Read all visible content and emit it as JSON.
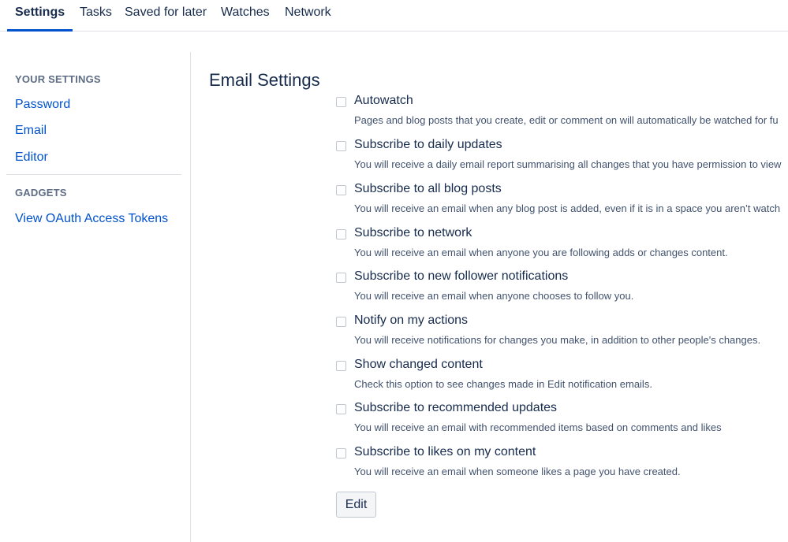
{
  "tabs": [
    {
      "label": "Settings",
      "active": true
    },
    {
      "label": "Tasks",
      "active": false
    },
    {
      "label": "Saved for later",
      "active": false
    },
    {
      "label": "Watches",
      "active": false
    },
    {
      "label": "Network",
      "active": false
    }
  ],
  "sidebar": {
    "your_settings_heading": "YOUR SETTINGS",
    "links": [
      {
        "label": "Password"
      },
      {
        "label": "Email"
      },
      {
        "label": "Editor"
      }
    ],
    "gadgets_heading": "GADGETS",
    "gadget_links": [
      {
        "label": "View OAuth Access Tokens"
      }
    ]
  },
  "main": {
    "title": "Email Settings",
    "options": [
      {
        "label": "Autowatch",
        "description": "Pages and blog posts that you create, edit or comment on will automatically be watched for fu",
        "checked": false
      },
      {
        "label": "Subscribe to daily updates",
        "description": "You will receive a daily email report summarising all changes that you have permission to view",
        "checked": false
      },
      {
        "label": "Subscribe to all blog posts",
        "description": "You will receive an email when any blog post is added, even if it is in a space you aren’t watch",
        "checked": false
      },
      {
        "label": "Subscribe to network",
        "description": "You will receive an email when anyone you are following adds or changes content.",
        "checked": false
      },
      {
        "label": "Subscribe to new follower notifications",
        "description": "You will receive an email when anyone chooses to follow you.",
        "checked": false
      },
      {
        "label": "Notify on my actions",
        "description": "You will receive notifications for changes you make, in addition to other people's changes.",
        "checked": false
      },
      {
        "label": "Show changed content",
        "description": "Check this option to see changes made in Edit notification emails.",
        "checked": false
      },
      {
        "label": "Subscribe to recommended updates",
        "description": "You will receive an email with recommended items based on comments and likes",
        "checked": false
      },
      {
        "label": "Subscribe to likes on my content",
        "description": "You will receive an email when someone likes a page you have created.",
        "checked": false
      }
    ],
    "edit_label": "Edit"
  },
  "colors": {
    "accent": "#0052cc",
    "text": "#172b4d",
    "muted": "#42526e",
    "border": "#dfe1e6"
  }
}
